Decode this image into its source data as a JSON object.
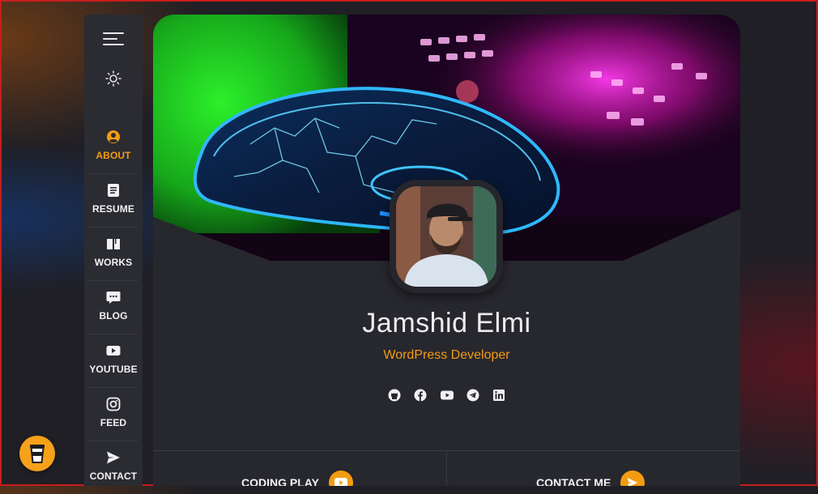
{
  "sidebar": {
    "items": [
      {
        "label": "ABOUT",
        "icon": "user-circle-icon",
        "active": true
      },
      {
        "label": "RESUME",
        "icon": "document-icon"
      },
      {
        "label": "WORKS",
        "icon": "book-icon"
      },
      {
        "label": "BLOG",
        "icon": "chat-bubble-icon"
      },
      {
        "label": "YOUTUBE",
        "icon": "youtube-icon"
      },
      {
        "label": "FEED",
        "icon": "instagram-icon"
      },
      {
        "label": "CONTACT",
        "icon": "send-icon"
      }
    ]
  },
  "profile": {
    "name": "Jamshid Elmi",
    "role": "WordPress Developer",
    "socials": [
      "github-icon",
      "facebook-icon",
      "youtube-icon",
      "telegram-icon",
      "linkedin-icon"
    ]
  },
  "actions": {
    "coding_play": "CODING PLAY",
    "contact_me": "CONTACT ME"
  },
  "colors": {
    "accent": "#f39c12",
    "background": "#1f1f25",
    "card": "#27272e",
    "sidebar": "#2b2b32"
  }
}
